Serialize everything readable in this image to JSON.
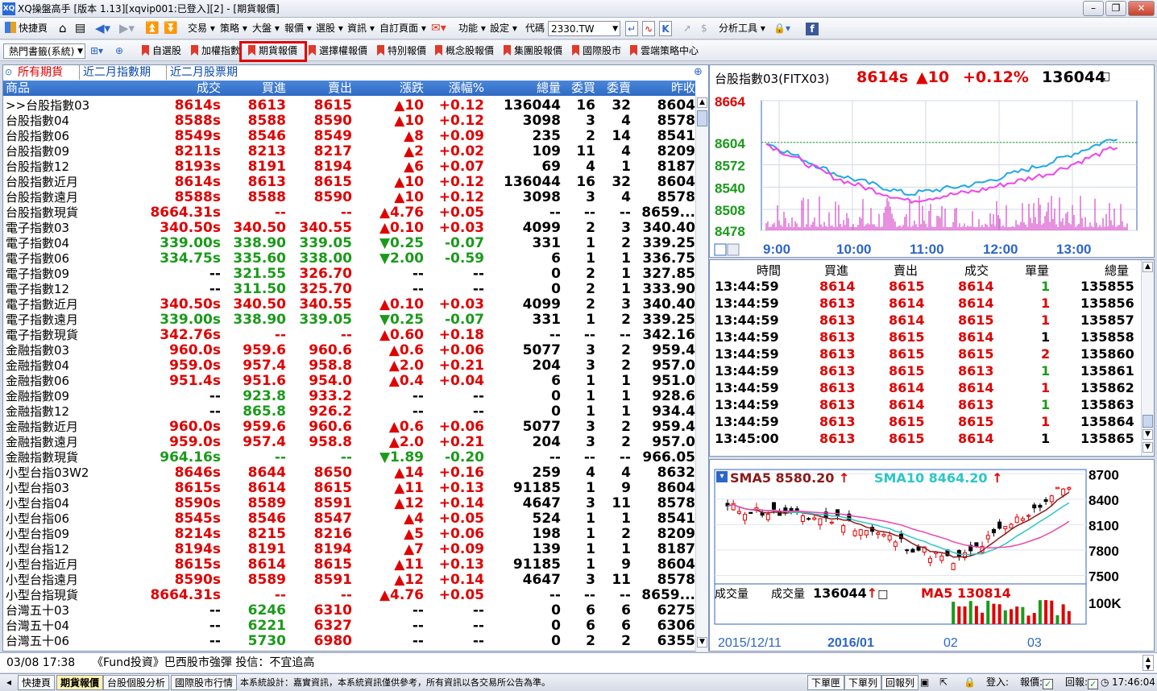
{
  "window": {
    "title": "XQ操盤高手 [版本 1.13][xqvip001:已登入][2] - [期貨報價]",
    "logo": "XQ",
    "min": "–",
    "restore": "❐",
    "close": "✕"
  },
  "menubar": {
    "items": [
      "快捷頁",
      "交易",
      "策略",
      "大盤",
      "報價",
      "選股",
      "資訊",
      "自訂頁面",
      "功能",
      "設定",
      "代碼"
    ],
    "symbol_value": "2330.TW",
    "analysis_tools": "分析工具"
  },
  "toolbar": {
    "page_select": "熱門書籤(系統)",
    "items": [
      "自選股",
      "加權指數",
      "期貨報價",
      "選擇權報價",
      "特別報價",
      "概念股報價",
      "集團股報價",
      "國際股市",
      "雲端策略中心"
    ]
  },
  "quote": {
    "tabs": [
      "所有期貨",
      "近二月指數期",
      "近二月股票期"
    ],
    "headers": [
      "商品",
      "成交",
      "買進",
      "賣出",
      "漲跌",
      "漲幅%",
      "總量",
      "委買",
      "委賣",
      "昨收"
    ],
    "rows": [
      {
        "name": ">>台股指數03",
        "last": "8614s",
        "bid": "8613",
        "ask": "8615",
        "chg": "▲10",
        "pct": "+0.12",
        "vol": "136044",
        "bq": "16",
        "aq": "32",
        "prev": "8604",
        "c": "r"
      },
      {
        "name": "台股指數04",
        "last": "8588s",
        "bid": "8588",
        "ask": "8590",
        "chg": "▲10",
        "pct": "+0.12",
        "vol": "3098",
        "bq": "3",
        "aq": "4",
        "prev": "8578",
        "c": "r"
      },
      {
        "name": "台股指數06",
        "last": "8549s",
        "bid": "8546",
        "ask": "8549",
        "chg": "▲8",
        "pct": "+0.09",
        "vol": "235",
        "bq": "2",
        "aq": "14",
        "prev": "8541",
        "c": "r"
      },
      {
        "name": "台股指數09",
        "last": "8211s",
        "bid": "8213",
        "ask": "8217",
        "chg": "▲2",
        "pct": "+0.02",
        "vol": "109",
        "bq": "11",
        "aq": "4",
        "prev": "8209",
        "c": "r"
      },
      {
        "name": "台股指數12",
        "last": "8193s",
        "bid": "8191",
        "ask": "8194",
        "chg": "▲6",
        "pct": "+0.07",
        "vol": "69",
        "bq": "4",
        "aq": "1",
        "prev": "8187",
        "c": "r"
      },
      {
        "name": "台股指數近月",
        "last": "8614s",
        "bid": "8613",
        "ask": "8615",
        "chg": "▲10",
        "pct": "+0.12",
        "vol": "136044",
        "bq": "16",
        "aq": "32",
        "prev": "8604",
        "c": "r"
      },
      {
        "name": "台股指數遠月",
        "last": "8588s",
        "bid": "8588",
        "ask": "8590",
        "chg": "▲10",
        "pct": "+0.12",
        "vol": "3098",
        "bq": "3",
        "aq": "4",
        "prev": "8578",
        "c": "r"
      },
      {
        "name": "台股指數現貨",
        "last": "8664.31s",
        "bid": "--",
        "ask": "--",
        "chg": "▲4.76",
        "pct": "+0.05",
        "vol": "--",
        "bq": "--",
        "aq": "--",
        "prev": "8659...",
        "c": "r"
      },
      {
        "name": "電子指數03",
        "last": "340.50s",
        "bid": "340.50",
        "ask": "340.55",
        "chg": "▲0.10",
        "pct": "+0.03",
        "vol": "4099",
        "bq": "2",
        "aq": "3",
        "prev": "340.40",
        "c": "r"
      },
      {
        "name": "電子指數04",
        "last": "339.00s",
        "bid": "338.90",
        "ask": "339.05",
        "chg": "▼0.25",
        "pct": "-0.07",
        "vol": "331",
        "bq": "1",
        "aq": "2",
        "prev": "339.25",
        "c": "g"
      },
      {
        "name": "電子指數06",
        "last": "334.75s",
        "bid": "335.60",
        "ask": "338.00",
        "chg": "▼2.00",
        "pct": "-0.59",
        "vol": "6",
        "bq": "1",
        "aq": "1",
        "prev": "336.75",
        "c": "g"
      },
      {
        "name": "電子指數09",
        "last": "--",
        "bid": "321.55",
        "ask": "326.70",
        "chg": "--",
        "pct": "--",
        "vol": "0",
        "bq": "2",
        "aq": "1",
        "prev": "327.85",
        "c": "n1"
      },
      {
        "name": "電子指數12",
        "last": "--",
        "bid": "311.50",
        "ask": "325.70",
        "chg": "--",
        "pct": "--",
        "vol": "0",
        "bq": "2",
        "aq": "1",
        "prev": "333.90",
        "c": "n1"
      },
      {
        "name": "電子指數近月",
        "last": "340.50s",
        "bid": "340.50",
        "ask": "340.55",
        "chg": "▲0.10",
        "pct": "+0.03",
        "vol": "4099",
        "bq": "2",
        "aq": "3",
        "prev": "340.40",
        "c": "r"
      },
      {
        "name": "電子指數遠月",
        "last": "339.00s",
        "bid": "338.90",
        "ask": "339.05",
        "chg": "▼0.25",
        "pct": "-0.07",
        "vol": "331",
        "bq": "1",
        "aq": "2",
        "prev": "339.25",
        "c": "g"
      },
      {
        "name": "電子指數現貨",
        "last": "342.76s",
        "bid": "--",
        "ask": "--",
        "chg": "▲0.60",
        "pct": "+0.18",
        "vol": "--",
        "bq": "--",
        "aq": "--",
        "prev": "342.16",
        "c": "r"
      },
      {
        "name": "金融指數03",
        "last": "960.0s",
        "bid": "959.6",
        "ask": "960.6",
        "chg": "▲0.6",
        "pct": "+0.06",
        "vol": "5077",
        "bq": "3",
        "aq": "2",
        "prev": "959.4",
        "c": "r"
      },
      {
        "name": "金融指數04",
        "last": "959.0s",
        "bid": "957.4",
        "ask": "958.8",
        "chg": "▲2.0",
        "pct": "+0.21",
        "vol": "204",
        "bq": "3",
        "aq": "2",
        "prev": "957.0",
        "c": "r"
      },
      {
        "name": "金融指數06",
        "last": "951.4s",
        "bid": "951.6",
        "ask": "954.0",
        "chg": "▲0.4",
        "pct": "+0.04",
        "vol": "6",
        "bq": "1",
        "aq": "1",
        "prev": "951.0",
        "c": "r"
      },
      {
        "name": "金融指數09",
        "last": "--",
        "bid": "923.8",
        "ask": "933.2",
        "chg": "--",
        "pct": "--",
        "vol": "0",
        "bq": "1",
        "aq": "1",
        "prev": "928.6",
        "c": "n2"
      },
      {
        "name": "金融指數12",
        "last": "--",
        "bid": "865.8",
        "ask": "926.2",
        "chg": "--",
        "pct": "--",
        "vol": "0",
        "bq": "1",
        "aq": "1",
        "prev": "934.4",
        "c": "n1"
      },
      {
        "name": "金融指數近月",
        "last": "960.0s",
        "bid": "959.6",
        "ask": "960.6",
        "chg": "▲0.6",
        "pct": "+0.06",
        "vol": "5077",
        "bq": "3",
        "aq": "2",
        "prev": "959.4",
        "c": "r"
      },
      {
        "name": "金融指數遠月",
        "last": "959.0s",
        "bid": "957.4",
        "ask": "958.8",
        "chg": "▲2.0",
        "pct": "+0.21",
        "vol": "204",
        "bq": "3",
        "aq": "2",
        "prev": "957.0",
        "c": "r"
      },
      {
        "name": "金融指數現貨",
        "last": "964.16s",
        "bid": "--",
        "ask": "--",
        "chg": "▼1.89",
        "pct": "-0.20",
        "vol": "--",
        "bq": "--",
        "aq": "--",
        "prev": "966.05",
        "c": "g"
      },
      {
        "name": "小型台指03W2",
        "last": "8646s",
        "bid": "8644",
        "ask": "8650",
        "chg": "▲14",
        "pct": "+0.16",
        "vol": "259",
        "bq": "4",
        "aq": "4",
        "prev": "8632",
        "c": "r"
      },
      {
        "name": "小型台指03",
        "last": "8615s",
        "bid": "8614",
        "ask": "8615",
        "chg": "▲11",
        "pct": "+0.13",
        "vol": "91185",
        "bq": "1",
        "aq": "9",
        "prev": "8604",
        "c": "r"
      },
      {
        "name": "小型台指04",
        "last": "8590s",
        "bid": "8589",
        "ask": "8591",
        "chg": "▲12",
        "pct": "+0.14",
        "vol": "4647",
        "bq": "3",
        "aq": "11",
        "prev": "8578",
        "c": "r"
      },
      {
        "name": "小型台指06",
        "last": "8545s",
        "bid": "8546",
        "ask": "8547",
        "chg": "▲4",
        "pct": "+0.05",
        "vol": "524",
        "bq": "1",
        "aq": "1",
        "prev": "8541",
        "c": "r"
      },
      {
        "name": "小型台指09",
        "last": "8214s",
        "bid": "8215",
        "ask": "8216",
        "chg": "▲5",
        "pct": "+0.06",
        "vol": "198",
        "bq": "1",
        "aq": "2",
        "prev": "8209",
        "c": "r"
      },
      {
        "name": "小型台指12",
        "last": "8194s",
        "bid": "8191",
        "ask": "8194",
        "chg": "▲7",
        "pct": "+0.09",
        "vol": "139",
        "bq": "1",
        "aq": "1",
        "prev": "8187",
        "c": "r"
      },
      {
        "name": "小型台指近月",
        "last": "8615s",
        "bid": "8614",
        "ask": "8615",
        "chg": "▲11",
        "pct": "+0.13",
        "vol": "91185",
        "bq": "1",
        "aq": "9",
        "prev": "8604",
        "c": "r"
      },
      {
        "name": "小型台指遠月",
        "last": "8590s",
        "bid": "8589",
        "ask": "8591",
        "chg": "▲12",
        "pct": "+0.14",
        "vol": "4647",
        "bq": "3",
        "aq": "11",
        "prev": "8578",
        "c": "r"
      },
      {
        "name": "小型台指現貨",
        "last": "8664.31s",
        "bid": "--",
        "ask": "--",
        "chg": "▲4.76",
        "pct": "+0.05",
        "vol": "--",
        "bq": "--",
        "aq": "--",
        "prev": "8659...",
        "c": "r"
      },
      {
        "name": "台灣五十03",
        "last": "--",
        "bid": "6246",
        "ask": "6310",
        "chg": "--",
        "pct": "--",
        "vol": "0",
        "bq": "6",
        "aq": "6",
        "prev": "6275",
        "c": "n2"
      },
      {
        "name": "台灣五十04",
        "last": "--",
        "bid": "6221",
        "ask": "6327",
        "chg": "--",
        "pct": "--",
        "vol": "0",
        "bq": "6",
        "aq": "6",
        "prev": "6306",
        "c": "n2"
      },
      {
        "name": "台灣五十06",
        "last": "--",
        "bid": "5730",
        "ask": "6980",
        "chg": "--",
        "pct": "--",
        "vol": "0",
        "bq": "2",
        "aq": "2",
        "prev": "6355",
        "c": "n2"
      }
    ]
  },
  "intraday": {
    "name": "台股指數03(FITX03)",
    "last": "8614s",
    "chg": "▲10",
    "pct": "+0.12%",
    "vol": "136044",
    "mark": "□",
    "yticks": [
      "8664",
      "8604",
      "8572",
      "8540",
      "8508",
      "8478"
    ],
    "xticks": [
      "9:00",
      "10:00",
      "11:00",
      "12:00",
      "13:00"
    ],
    "chart_data": {
      "type": "line",
      "x": [
        "9:00",
        "10:00",
        "11:00",
        "12:00",
        "13:00",
        "13:45"
      ],
      "series": [
        {
          "values": [
            8604,
            8558,
            8530,
            8545,
            8575,
            8614
          ]
        },
        {
          "values": [
            8602,
            8552,
            8520,
            8535,
            8560,
            8600
          ]
        }
      ],
      "ylim": [
        8478,
        8664
      ],
      "grid": true
    }
  },
  "ticks": {
    "headers": [
      "時間",
      "買進",
      "賣出",
      "成交",
      "單量",
      "總量"
    ],
    "rows": [
      {
        "t": "13:44:59",
        "b": "8614",
        "a": "8615",
        "p": "8614",
        "q": "1",
        "v": "135855",
        "qc": "g"
      },
      {
        "t": "13:44:59",
        "b": "8613",
        "a": "8614",
        "p": "8614",
        "q": "1",
        "v": "135856",
        "qc": "r"
      },
      {
        "t": "13:44:59",
        "b": "8613",
        "a": "8614",
        "p": "8615",
        "q": "1",
        "v": "135857",
        "qc": "r"
      },
      {
        "t": "13:44:59",
        "b": "8613",
        "a": "8615",
        "p": "8614",
        "q": "1",
        "v": "135858",
        "qc": "k"
      },
      {
        "t": "13:44:59",
        "b": "8613",
        "a": "8615",
        "p": "8615",
        "q": "2",
        "v": "135860",
        "qc": "r"
      },
      {
        "t": "13:44:59",
        "b": "8613",
        "a": "8615",
        "p": "8613",
        "q": "1",
        "v": "135861",
        "qc": "g"
      },
      {
        "t": "13:44:59",
        "b": "8613",
        "a": "8614",
        "p": "8614",
        "q": "1",
        "v": "135862",
        "qc": "r"
      },
      {
        "t": "13:44:59",
        "b": "8613",
        "a": "8614",
        "p": "8613",
        "q": "1",
        "v": "135863",
        "qc": "g"
      },
      {
        "t": "13:44:59",
        "b": "8613",
        "a": "8615",
        "p": "8615",
        "q": "1",
        "v": "135864",
        "qc": "r"
      },
      {
        "t": "13:45:00",
        "b": "8613",
        "a": "8615",
        "p": "8614",
        "q": "1",
        "v": "135865",
        "qc": "k"
      }
    ]
  },
  "kline": {
    "sma5": "SMA5 8580.20",
    "sma10": "SMA10 8464.20",
    "yticks": [
      "8700",
      "8400",
      "8100",
      "7800",
      "7500"
    ],
    "vol_label": "成交量",
    "vol_title": "成交量",
    "vol_value": "136044",
    "vol_mark": "□",
    "ma5_label": "MA5 130814",
    "vol_ytick": "100K",
    "xticks": [
      "2015/12/11",
      "2016/01",
      "02",
      "03"
    ],
    "chart_data": {
      "type": "line",
      "x": [
        "2015/12/11",
        "2016/01",
        "02",
        "03"
      ],
      "series": [
        {
          "values": [
            8300,
            8150,
            7650,
            8580
          ]
        },
        {
          "values": [
            8250,
            8200,
            7700,
            8464
          ]
        }
      ],
      "ylim": [
        7400,
        8750
      ]
    }
  },
  "news": {
    "time": "03/08 17:38",
    "text": "《Fund投資》巴西股市強彈 投信：不宜追高"
  },
  "statusbar": {
    "tabs": [
      "快捷頁",
      "期貨報價",
      "台股個股分析",
      "國際股市行情"
    ],
    "info": "本系統設計：嘉實資訊，本系統資訊僅供參考，所有資訊以各交易所公告為準。",
    "btns": [
      "下單匣",
      "下單列",
      "回報列"
    ],
    "login": "登入:",
    "report": "報價:",
    "reply": "回報:",
    "clock": "17:46:04"
  },
  "colors": {
    "up": "#e00000",
    "down": "#1a9a1a",
    "header": "#2f6bc5",
    "highlight": "#e00000"
  }
}
